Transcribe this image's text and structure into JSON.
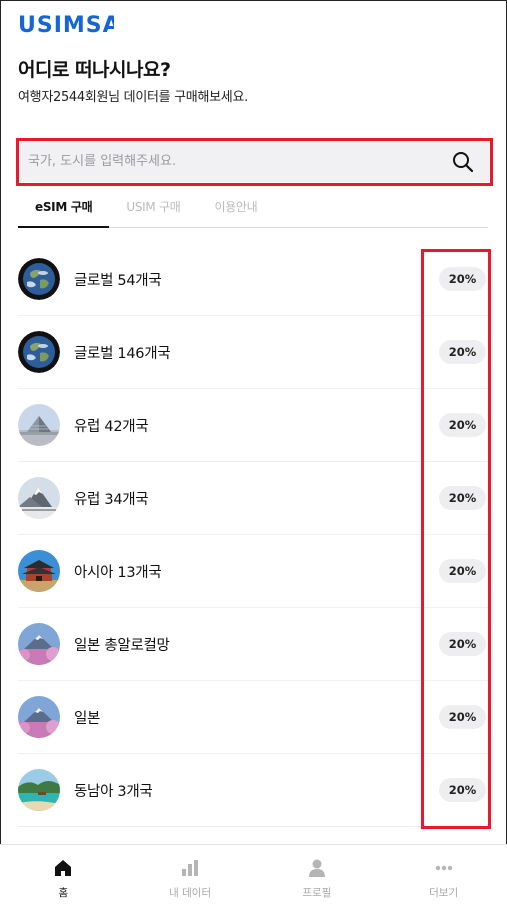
{
  "header": {
    "logo_text": "USIMSA",
    "title": "어디로 떠나시나요?",
    "subtitle": "여행자2544회원님 데이터를 구매해보세요."
  },
  "search": {
    "placeholder": "국가, 도시를 입력해주세요."
  },
  "tabs": [
    {
      "label": "eSIM 구매",
      "active": true
    },
    {
      "label": "USIM 구매",
      "active": false
    },
    {
      "label": "이용안내",
      "active": false
    }
  ],
  "products": [
    {
      "name": "글로벌 54개국",
      "discount": "20%",
      "image": "globe"
    },
    {
      "name": "글로벌 146개국",
      "discount": "20%",
      "image": "globe"
    },
    {
      "name": "유럽 42개국",
      "discount": "20%",
      "image": "louvre"
    },
    {
      "name": "유럽 34개국",
      "discount": "20%",
      "image": "mountain"
    },
    {
      "name": "아시아 13개국",
      "discount": "20%",
      "image": "palace"
    },
    {
      "name": "일본 총알로컬망",
      "discount": "20%",
      "image": "fuji-blossom"
    },
    {
      "name": "일본",
      "discount": "20%",
      "image": "fuji-blossom"
    },
    {
      "name": "동남아 3개국",
      "discount": "20%",
      "image": "beach"
    }
  ],
  "bottom_nav": [
    {
      "label": "홈",
      "icon": "home-icon",
      "active": true
    },
    {
      "label": "내 데이터",
      "icon": "bar-chart-icon",
      "active": false
    },
    {
      "label": "프로필",
      "icon": "person-icon",
      "active": false
    },
    {
      "label": "더보기",
      "icon": "more-dots-icon",
      "active": false
    }
  ],
  "colors": {
    "brand": "#1565d8",
    "highlight": "#e8192c",
    "badge_bg": "#eeeef0"
  }
}
